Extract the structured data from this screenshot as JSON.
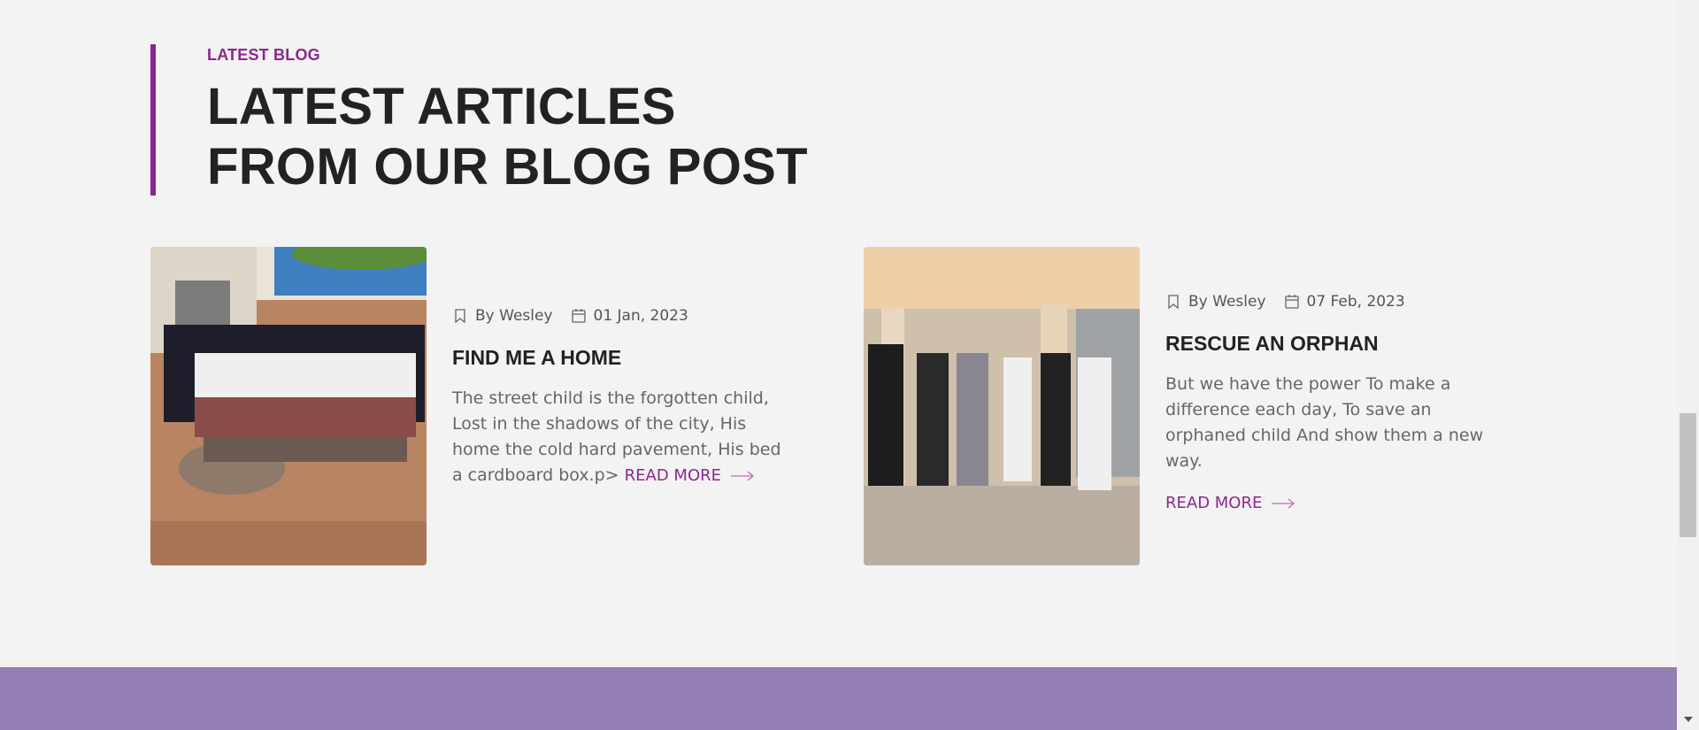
{
  "section": {
    "eyebrow": "LATEST BLOG",
    "heading": "LATEST ARTICLES FROM OUR BLOG POST",
    "accent_color": "#8e2590"
  },
  "posts": [
    {
      "author": "By Wesley",
      "date": "01 Jan, 2023",
      "title": "FIND ME A HOME",
      "excerpt": "The street child is the forgotten child, Lost in the shadows of the city, His home the cold hard pavement, His bed a cardboard box.p>",
      "read_more": "READ MORE",
      "image": "group-of-schoolgirls-photo"
    },
    {
      "author": "By Wesley",
      "date": "07 Feb, 2023",
      "title": "RESCUE AN ORPHAN",
      "excerpt": "But we have the power To make a difference each day, To save an orphaned child And show them a new way.",
      "read_more": "READ MORE",
      "image": "girls-boxing-class-photo"
    }
  ],
  "icons": {
    "author": "bookmark-icon",
    "date": "calendar-icon",
    "read_more": "arrow-right-icon"
  },
  "colors": {
    "background": "#f3f3f3",
    "footer_band": "#937fb3"
  }
}
